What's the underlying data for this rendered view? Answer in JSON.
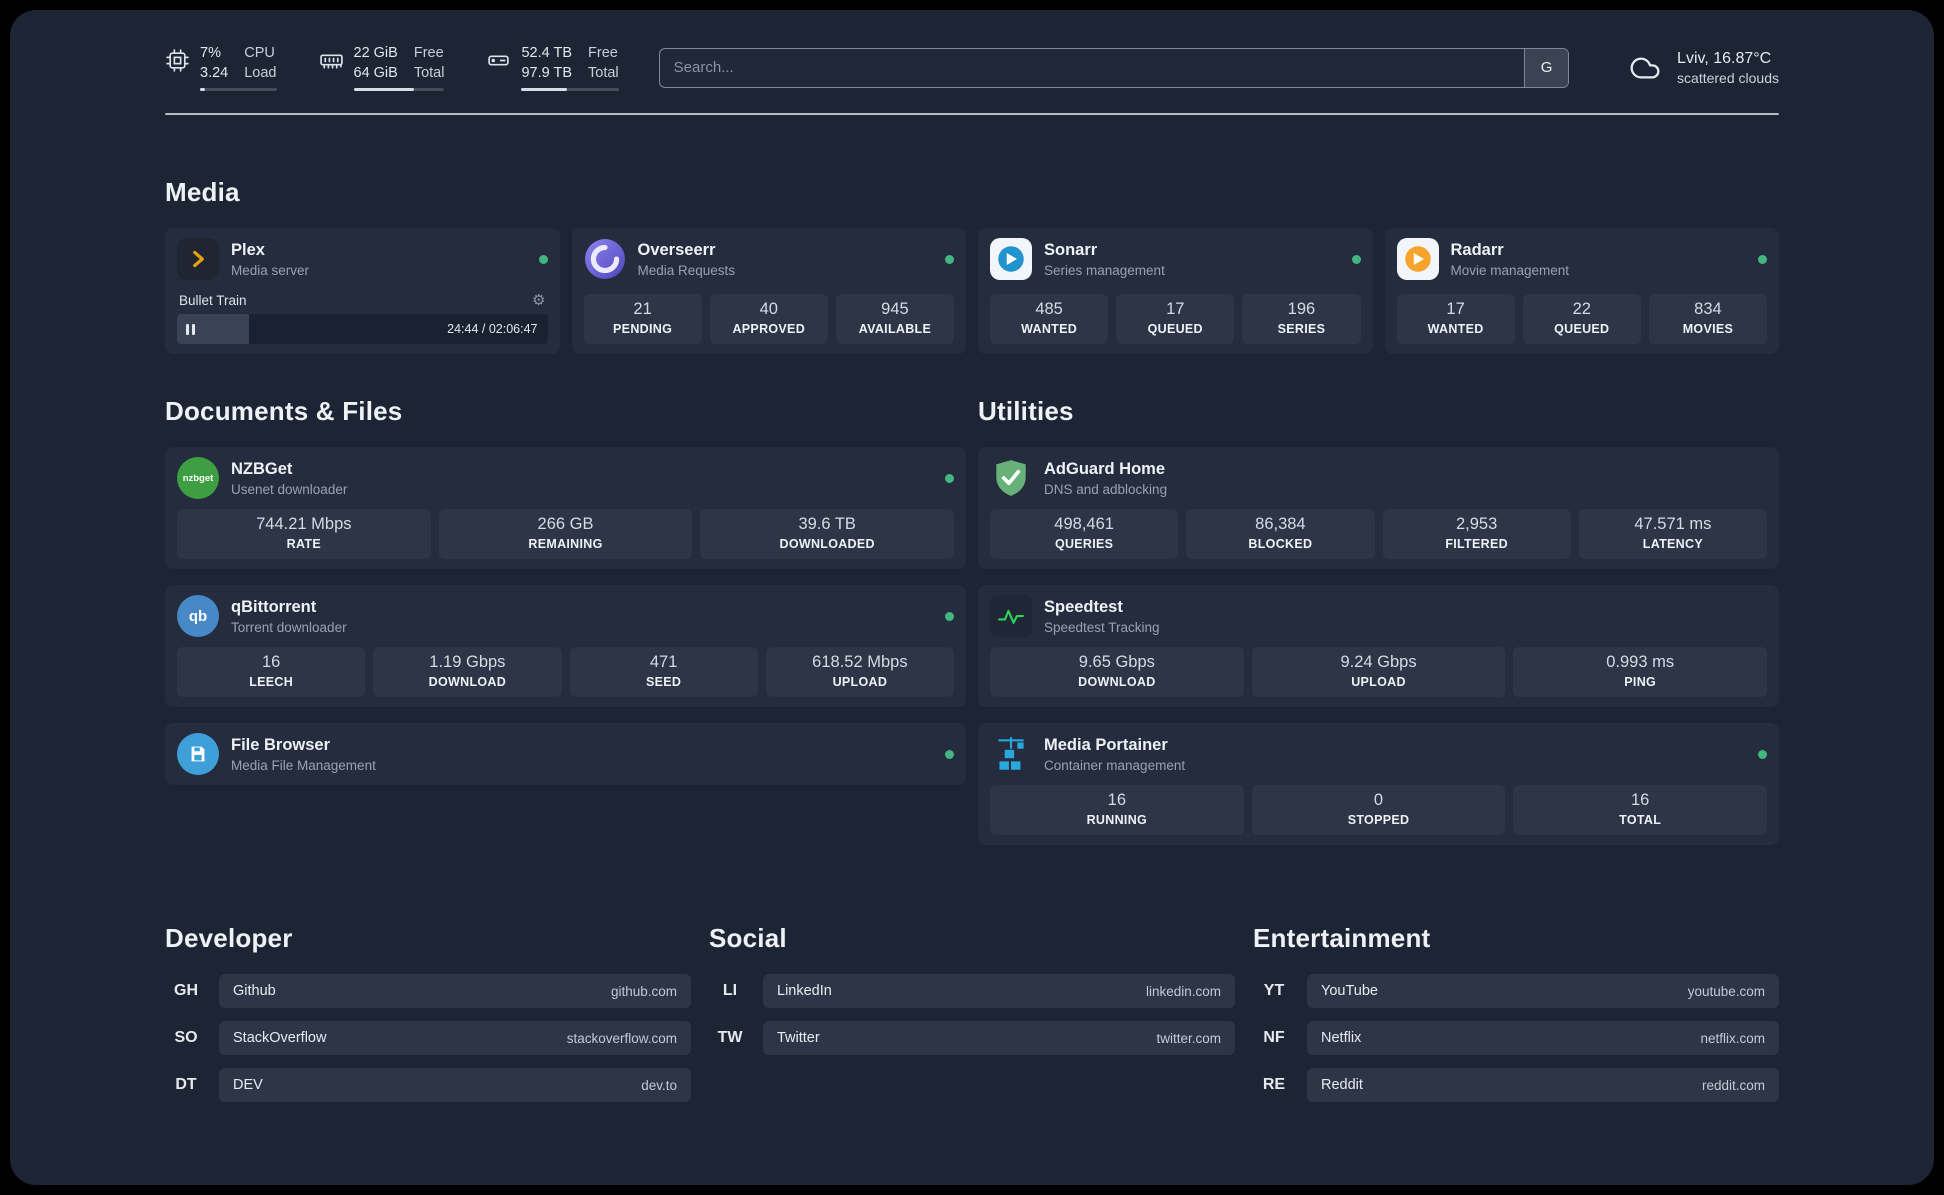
{
  "theme": {
    "panel_bg": "#1d2433",
    "card_bg": "#242c3d",
    "tile_bg": "#2d3547",
    "status_online": "#43b581",
    "plex_gold": "#e5a00d"
  },
  "icons": {
    "gear": "⚙"
  },
  "header": {
    "cpu": {
      "value1": "7%",
      "value2": "3.24",
      "label1": "CPU",
      "label2": "Load"
    },
    "memory": {
      "value1": "22 GiB",
      "value2": "64 GiB",
      "label1": "Free",
      "label2": "Total"
    },
    "disk": {
      "value1": "52.4 TB",
      "value2": "97.9 TB",
      "label1": "Free",
      "label2": "Total"
    },
    "search": {
      "placeholder": "Search...",
      "button": "G"
    },
    "weather": {
      "location": "Lviv, 16.87°C",
      "condition": "scattered clouds"
    }
  },
  "sections": {
    "media": {
      "title": "Media"
    },
    "documents": {
      "title": "Documents & Files"
    },
    "utilities": {
      "title": "Utilities"
    }
  },
  "services": {
    "plex": {
      "name": "Plex",
      "desc": "Media server",
      "now_playing": {
        "title": "Bullet Train",
        "time": "24:44 / 02:06:47"
      }
    },
    "overseerr": {
      "name": "Overseerr",
      "desc": "Media Requests",
      "stats": [
        {
          "value": "21",
          "label": "PENDING"
        },
        {
          "value": "40",
          "label": "APPROVED"
        },
        {
          "value": "945",
          "label": "AVAILABLE"
        }
      ]
    },
    "sonarr": {
      "name": "Sonarr",
      "desc": "Series management",
      "stats": [
        {
          "value": "485",
          "label": "WANTED"
        },
        {
          "value": "17",
          "label": "QUEUED"
        },
        {
          "value": "196",
          "label": "SERIES"
        }
      ]
    },
    "radarr": {
      "name": "Radarr",
      "desc": "Movie management",
      "stats": [
        {
          "value": "17",
          "label": "WANTED"
        },
        {
          "value": "22",
          "label": "QUEUED"
        },
        {
          "value": "834",
          "label": "MOVIES"
        }
      ]
    },
    "nzbget": {
      "name": "NZBGet",
      "desc": "Usenet downloader",
      "icon_text": "nzbget",
      "stats": [
        {
          "value": "744.21 Mbps",
          "label": "RATE"
        },
        {
          "value": "266 GB",
          "label": "REMAINING"
        },
        {
          "value": "39.6 TB",
          "label": "DOWNLOADED"
        }
      ]
    },
    "qbittorrent": {
      "name": "qBittorrent",
      "desc": "Torrent downloader",
      "icon_text": "qb",
      "stats": [
        {
          "value": "16",
          "label": "LEECH"
        },
        {
          "value": "1.19 Gbps",
          "label": "DOWNLOAD"
        },
        {
          "value": "471",
          "label": "SEED"
        },
        {
          "value": "618.52 Mbps",
          "label": "UPLOAD"
        }
      ]
    },
    "filebrowser": {
      "name": "File Browser",
      "desc": "Media File Management"
    },
    "adguard": {
      "name": "AdGuard Home",
      "desc": "DNS and adblocking",
      "stats": [
        {
          "value": "498,461",
          "label": "QUERIES"
        },
        {
          "value": "86,384",
          "label": "BLOCKED"
        },
        {
          "value": "2,953",
          "label": "FILTERED"
        },
        {
          "value": "47.571 ms",
          "label": "LATENCY"
        }
      ]
    },
    "speedtest": {
      "name": "Speedtest",
      "desc": "Speedtest Tracking",
      "stats": [
        {
          "value": "9.65 Gbps",
          "label": "DOWNLOAD"
        },
        {
          "value": "9.24 Gbps",
          "label": "UPLOAD"
        },
        {
          "value": "0.993 ms",
          "label": "PING"
        }
      ]
    },
    "portainer": {
      "name": "Media Portainer",
      "desc": "Container management",
      "stats": [
        {
          "value": "16",
          "label": "RUNNING"
        },
        {
          "value": "0",
          "label": "STOPPED"
        },
        {
          "value": "16",
          "label": "TOTAL"
        }
      ]
    }
  },
  "bookmarks": {
    "developer": {
      "title": "Developer",
      "items": [
        {
          "abbr": "GH",
          "name": "Github",
          "url": "github.com"
        },
        {
          "abbr": "SO",
          "name": "StackOverflow",
          "url": "stackoverflow.com"
        },
        {
          "abbr": "DT",
          "name": "DEV",
          "url": "dev.to"
        }
      ]
    },
    "social": {
      "title": "Social",
      "items": [
        {
          "abbr": "LI",
          "name": "LinkedIn",
          "url": "linkedin.com"
        },
        {
          "abbr": "TW",
          "name": "Twitter",
          "url": "twitter.com"
        }
      ]
    },
    "entertainment": {
      "title": "Entertainment",
      "items": [
        {
          "abbr": "YT",
          "name": "YouTube",
          "url": "youtube.com"
        },
        {
          "abbr": "NF",
          "name": "Netflix",
          "url": "netflix.com"
        },
        {
          "abbr": "RE",
          "name": "Reddit",
          "url": "reddit.com"
        }
      ]
    }
  }
}
